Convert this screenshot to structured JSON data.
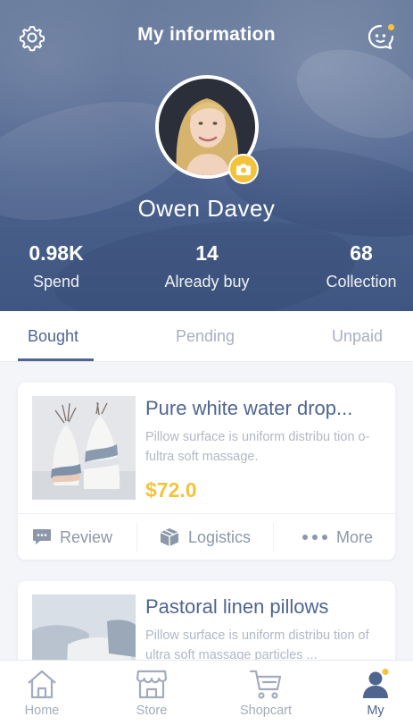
{
  "header": {
    "title": "My information",
    "user_name": "Owen Davey",
    "stats": [
      {
        "value": "0.98K",
        "label": "Spend"
      },
      {
        "value": "14",
        "label": "Already buy"
      },
      {
        "value": "68",
        "label": "Collection"
      }
    ],
    "icons": {
      "left": "settings-gear-icon",
      "right": "chat-bubble-icon",
      "avatar_badge": "camera-icon"
    }
  },
  "tabs": [
    {
      "label": "Bought",
      "active": true
    },
    {
      "label": "Pending",
      "active": false
    },
    {
      "label": "Unpaid",
      "active": false
    }
  ],
  "orders": [
    {
      "title": "Pure white water drop...",
      "description": "Pillow surface is uniform distribu tion o-fultra soft massage.",
      "price": "$72.0",
      "actions": [
        {
          "label": "Review",
          "icon": "comment-icon"
        },
        {
          "label": "Logistics",
          "icon": "box-icon"
        },
        {
          "label": "More",
          "icon": "more-dots-icon"
        }
      ]
    },
    {
      "title": "Pastoral linen pillows",
      "description": "Pillow surface is uniform distribu tion of ultra soft massage particles ..."
    }
  ],
  "bottom_nav": [
    {
      "label": "Home",
      "icon": "home-icon",
      "active": false
    },
    {
      "label": "Store",
      "icon": "store-icon",
      "active": false
    },
    {
      "label": "Shopcart",
      "icon": "cart-icon",
      "active": false
    },
    {
      "label": "My",
      "icon": "user-icon",
      "active": true
    }
  ],
  "colors": {
    "primary": "#4f6590",
    "accent": "#f4c33a",
    "muted_text": "#a8b0bf",
    "background": "#f3f5f9"
  }
}
